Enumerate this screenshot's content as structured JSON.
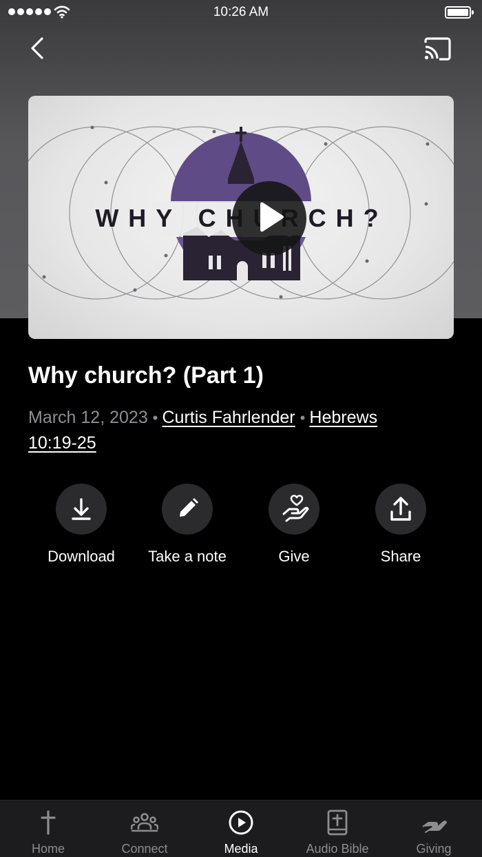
{
  "status_bar": {
    "time": "10:26 AM"
  },
  "sermon": {
    "thumbnail_text": "WHY CHURCH?",
    "title": "Why church? (Part 1)",
    "date": "March 12, 2023",
    "speaker": "Curtis Fahrlender",
    "scripture_line1": "Hebrews",
    "scripture_line2": "10:19-25"
  },
  "actions": [
    {
      "label": "Download",
      "icon": "download-icon"
    },
    {
      "label": "Take a note",
      "icon": "pencil-icon"
    },
    {
      "label": "Give",
      "icon": "hand-heart-icon"
    },
    {
      "label": "Share",
      "icon": "share-icon"
    }
  ],
  "tabs": [
    {
      "label": "Home",
      "icon": "cross-icon",
      "active": false
    },
    {
      "label": "Connect",
      "icon": "people-icon",
      "active": false
    },
    {
      "label": "Media",
      "icon": "play-circle-icon",
      "active": true
    },
    {
      "label": "Audio Bible",
      "icon": "bible-icon",
      "active": false
    },
    {
      "label": "Giving",
      "icon": "giving-hand-icon",
      "active": false
    }
  ],
  "colors": {
    "background": "#000000",
    "header_gray": "#5d5d60",
    "muted_text": "#8e8e92",
    "action_circle": "#2b2b2d",
    "tab_bar": "#1c1c1e",
    "thumbnail_purple": "#5f4b86"
  }
}
